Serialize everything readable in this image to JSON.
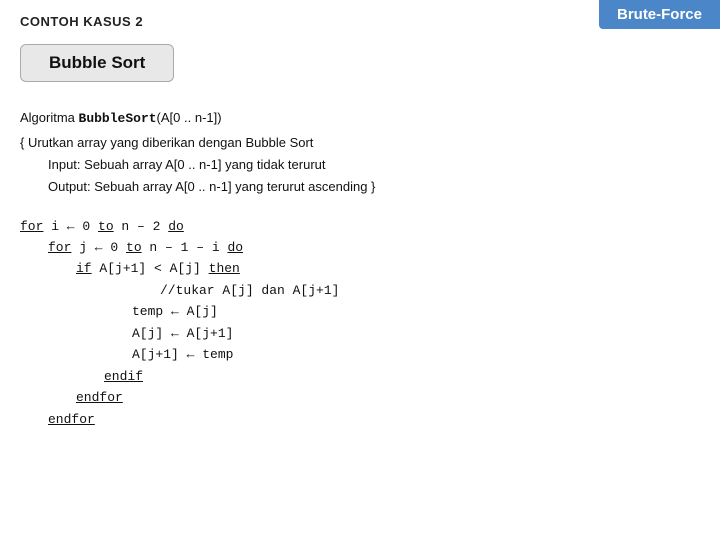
{
  "header": {
    "badge_label": "Brute-Force",
    "title_label": "CONTOH KASUS 2"
  },
  "bubble_sort_box": {
    "label": "Bubble Sort"
  },
  "algorithm": {
    "line1_normal": "Algoritma ",
    "line1_code": "BubbleSort",
    "line1_rest": "(A[0 .. n-1])",
    "line2": "{ Urutkan array yang diberikan dengan Bubble Sort",
    "line3_label": "Input",
    "line3_rest": ": Sebuah array A[0 .. n-1] yang tidak terurut",
    "line4_label": "Output",
    "line4_rest": ": Sebuah array A[0 .. n-1] yang terurut ascending }"
  },
  "code": {
    "line1": "for",
    "line1_rest": " i ← 0 ",
    "line1_to": "to",
    "line1_end": " n – 2 ",
    "line1_do": "do",
    "line2": "for",
    "line2_rest": " j ← 0 ",
    "line2_to": "to",
    "line2_end": " n – 1 – i ",
    "line2_do": "do",
    "line3_if": "if",
    "line3_rest": " A[j+1] < A[j] ",
    "line3_then": "then",
    "line4": "//tukar A[j] dan A[j+1]",
    "line5": "temp ← A[j]",
    "line6": "A[j] ← A[j+1]",
    "line7": "A[j+1] ← temp",
    "line8": "endif",
    "line9": "endfor",
    "line10": "endfor"
  }
}
